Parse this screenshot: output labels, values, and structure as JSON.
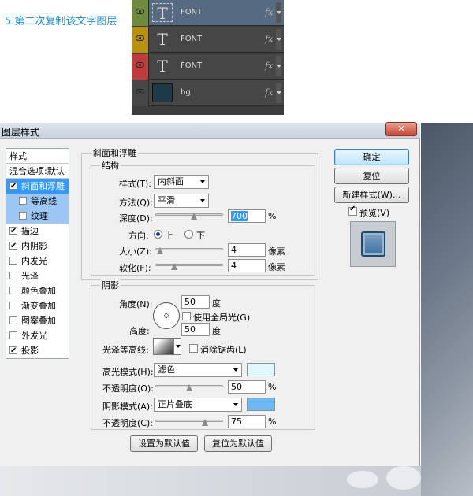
{
  "caption": "5.第二次复制该文字图层",
  "layers": [
    {
      "name": "FONT",
      "thumb": "T",
      "eye_color": "#6d8b3b",
      "fx": "fx",
      "row_bg": "#566a82",
      "selected": true
    },
    {
      "name": "FONT",
      "thumb": "T",
      "eye_color": "#b8920e",
      "fx": "fx",
      "row_bg": "#464646"
    },
    {
      "name": "FONT",
      "thumb": "T",
      "eye_color": "#c03c3c",
      "fx": "fx",
      "row_bg": "#464646"
    },
    {
      "name": "bg",
      "thumb": "",
      "eye_color": "#464646",
      "fx": "fx",
      "row_bg": "#464646"
    }
  ],
  "dialog": {
    "title": "图层样式",
    "close": "✕",
    "styles_header": "样式",
    "blend_default": "混合选项:默认",
    "style_items": [
      {
        "label": "斜面和浮雕",
        "checked": true,
        "state": "selected"
      },
      {
        "label": "等高线",
        "checked": false,
        "state": "sub"
      },
      {
        "label": "纹理",
        "checked": false,
        "state": "sub"
      },
      {
        "label": "描边",
        "checked": true
      },
      {
        "label": "内阴影",
        "checked": true
      },
      {
        "label": "内发光",
        "checked": false
      },
      {
        "label": "光泽",
        "checked": false
      },
      {
        "label": "颜色叠加",
        "checked": false
      },
      {
        "label": "渐变叠加",
        "checked": false
      },
      {
        "label": "图案叠加",
        "checked": false
      },
      {
        "label": "外发光",
        "checked": false
      },
      {
        "label": "投影",
        "checked": true
      }
    ],
    "bevel": {
      "group_title": "斜面和浮雕",
      "structure_title": "结构",
      "style_label": "样式(T):",
      "style_value": "内斜面",
      "method_label": "方法(Q):",
      "method_value": "平滑",
      "depth_label": "深度(D):",
      "depth_value": "700",
      "depth_unit": "%",
      "depth_slider": 0.58,
      "direction_label": "方向:",
      "dir_up": "上",
      "dir_down": "下",
      "size_label": "大小(Z):",
      "size_value": "4",
      "size_unit": "像素",
      "size_slider": 0.03,
      "soften_label": "软化(F):",
      "soften_value": "4",
      "soften_unit": "像素",
      "soften_slider": 0.25
    },
    "shading": {
      "title": "阴影",
      "angle_label": "角度(N):",
      "angle_value": "50",
      "angle_unit": "度",
      "global_light": "使用全局光(G)",
      "altitude_label": "高度:",
      "altitude_value": "50",
      "altitude_unit": "度",
      "gloss_label": "光泽等高线:",
      "antialias": "消除锯齿(L)",
      "highlight_label": "高光模式(H):",
      "highlight_value": "滤色",
      "highlight_color": "#dff9ff",
      "hl_opacity_label": "不透明度(O):",
      "hl_opacity_value": "50",
      "hl_opacity_slider": 0.5,
      "shadow_label": "阴影模式(A):",
      "shadow_value": "正片叠底",
      "shadow_color": "#6eb8f4",
      "sh_opacity_label": "不透明度(C):",
      "sh_opacity_value": "75",
      "sh_opacity_slider": 0.75,
      "pct": "%"
    },
    "make_default": "设置为默认值",
    "reset_default": "复位为默认值",
    "ok": "确定",
    "reset": "复位",
    "new_style": "新建样式(W)...",
    "preview_label": "预览(V)"
  }
}
